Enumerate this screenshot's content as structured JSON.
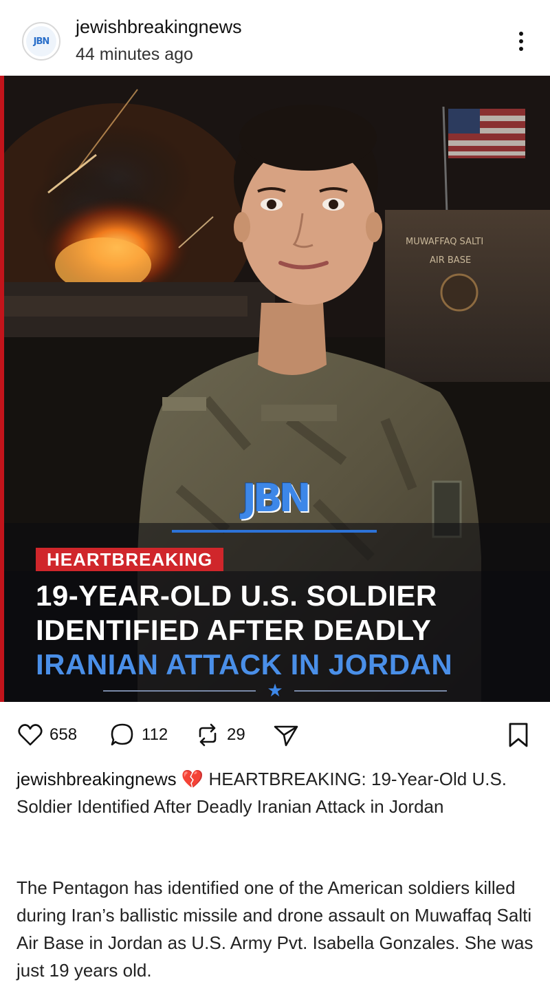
{
  "post": {
    "username": "jewishbreakingnews",
    "time_ago": "44 minutes ago",
    "avatar_text": "JBN"
  },
  "image": {
    "logo": "JBN",
    "tag": "HEARTBREAKING",
    "headline_lines": [
      "19-YEAR-OLD U.S. SOLDIER",
      "IDENTIFIED AFTER DEADLY",
      "IRANIAN ATTACK IN JORDAN"
    ],
    "sign_text_line1": "MUWAFFAQ SALTI",
    "sign_text_line2": "AIR BASE",
    "star": "★",
    "colors": {
      "accent_red": "#d0262b",
      "accent_blue": "#4a8fe8"
    }
  },
  "actions": {
    "likes": "658",
    "comments": "112",
    "reposts": "29",
    "icons": [
      "heart-icon",
      "comment-icon",
      "repost-icon",
      "share-icon",
      "bookmark-icon"
    ]
  },
  "caption": {
    "username": "jewishbreakingnews",
    "emoji": "💔",
    "text": "HEARTBREAKING: 19-Year-Old U.S. Soldier Identified After Deadly Iranian Attack in Jordan"
  },
  "body": "The Pentagon has identified one of the American soldiers killed during Iran’s ballistic missile and drone assault on Muwaffaq Salti Air Base in Jordan as U.S. Army Pvt. Isabella Gonzales. She was just 19 years old."
}
